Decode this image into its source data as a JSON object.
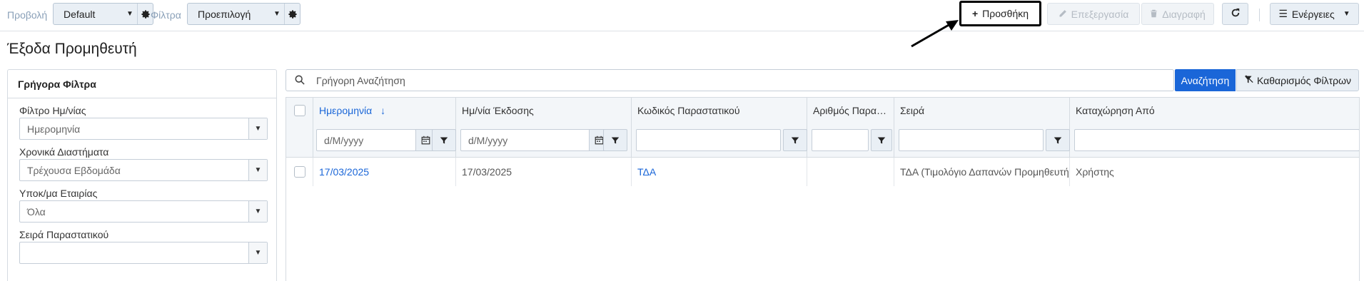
{
  "toolbar": {
    "view_label": "Προβολή",
    "view_value": "Default",
    "filters_label": "Φίλτρα",
    "filters_value": "Προεπιλογή",
    "add_label": "Προσθήκη",
    "edit_label": "Επεξεργασία",
    "delete_label": "Διαγραφή",
    "actions_label": "Ενέργειες",
    "icons": [
      "gear-icon",
      "plus-icon",
      "pencil-icon",
      "trash-icon",
      "refresh-icon",
      "menu-icon",
      "chevron-down-icon"
    ]
  },
  "page": {
    "title": "Έξοδα Προμηθευτή"
  },
  "quick_filters": {
    "title": "Γρήγορα Φίλτρα",
    "fields": [
      {
        "label": "Φίλτρο Ημ/νίας",
        "value": "Ημερομηνία"
      },
      {
        "label": "Χρονικά Διαστήματα",
        "value": "Τρέχουσα Εβδομάδα"
      },
      {
        "label": "Υποκ/μα Εταιρίας",
        "value": "Όλα"
      },
      {
        "label": "Σειρά Παραστατικού",
        "value": ""
      }
    ]
  },
  "search": {
    "placeholder": "Γρήγορη Αναζήτηση",
    "search_label": "Αναζήτηση",
    "clear_label": "Καθαρισμός Φίλτρων"
  },
  "grid": {
    "columns": [
      {
        "label": "Ημερομηνία",
        "sorted": "desc",
        "filter_placeholder": "d/M/yyyy"
      },
      {
        "label": "Ημ/νία Έκδοσης",
        "filter_placeholder": "d/M/yyyy"
      },
      {
        "label": "Κωδικός Παραστατικού",
        "filter_placeholder": ""
      },
      {
        "label": "Αριθμός Παραστατικού",
        "filter_placeholder": ""
      },
      {
        "label": "Σειρά",
        "filter_placeholder": ""
      },
      {
        "label": "Καταχώρηση Από",
        "filter_placeholder": ""
      }
    ],
    "rows": [
      [
        "17/03/2025",
        "17/03/2025",
        "ΤΔΑ",
        "",
        "ΤΔΑ (Τιμολόγιο Δαπανών Προμηθευτή)",
        "Χρήστης"
      ]
    ]
  },
  "colors": {
    "accent": "#1a66d8",
    "toolbar_button_bg": "#e9eff5",
    "highlight_border": "#000000"
  }
}
